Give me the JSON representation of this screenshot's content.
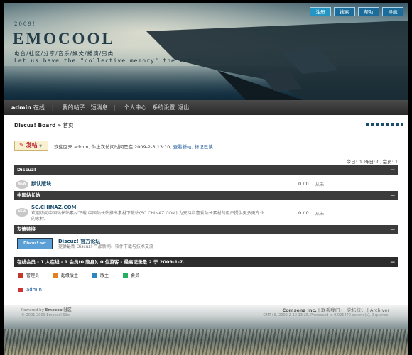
{
  "header": {
    "year": "2009!",
    "logo": "EMOCOOL",
    "slogan_cn": "电台/社区/分享/音乐/娱文/播演/另类...",
    "slogan_en": "Let us have the \"collective memory\" the voice!",
    "top_links": [
      "注册",
      "搜索",
      "帮助",
      "导航"
    ]
  },
  "nav": {
    "user": "admin",
    "status": "在线",
    "items": [
      "我的帖子",
      "短消息",
      "个人中心",
      "系统设置",
      "退出"
    ]
  },
  "breadcrumb": {
    "board": "Discuz! Board",
    "sep": "»",
    "page": "首页"
  },
  "post_button": "发帖",
  "welcome": {
    "text": "欢迎回来 admin, 你上次访问时间是在 2009-2-3 13:10,",
    "link1": "查看新帖",
    "comma": ",",
    "link2": "标记已读"
  },
  "stats": "今日: 0, 昨日: 0, 会员: 1",
  "categories": [
    {
      "title": "Discuz!",
      "toggle": "—"
    },
    {
      "title": "中国站长站",
      "toggle": "—"
    },
    {
      "title": "友情链接",
      "toggle": "—"
    }
  ],
  "forums": [
    {
      "badge": "NEW",
      "name": "默认版块",
      "desc": "",
      "count": "0 / 0",
      "last": "从未"
    },
    {
      "badge": "NEW",
      "name": "SC.CHINAZ.COM",
      "desc": "欢迎访问中国站长站素材下载,中国站长站推出素材下载站(SC.CHINAZ.COM),为支持和喜爱站长素材的用户提供更多更专业的素材。",
      "count": "0 / 0",
      "last": "从未"
    }
  ],
  "partner": {
    "logo_text": "Discuz! net",
    "name": "Discuz! 官方论坛",
    "desc": "提供最新 Discuz! 产品新闻、软件下载与技术交流"
  },
  "online": {
    "bar": "在线会员 - 1 人在线 - 1 会员(0 隐身), 0 位游客 - 最高记录是 2 于 2009-1-7.",
    "toggle": "—",
    "legend": [
      {
        "label": "管理员",
        "color": "#c0392b"
      },
      {
        "label": "超级版主",
        "color": "#e67e22"
      },
      {
        "label": "版主",
        "color": "#2e86c1"
      },
      {
        "label": "会员",
        "color": "#27ae60"
      }
    ],
    "user": "admin"
  },
  "footer": {
    "powered_prefix": "Powered by",
    "powered_name": "Emocool社区",
    "copyright": "© 2001-2009 Emocool Site",
    "company": "Comsenz Inc.",
    "links": "| 联系我们 | | 论坛统计 | Archiver",
    "gmt": "GMT+8, 2009-2-13 13:25, Processed in 0.025470 second(s), 9 queries."
  }
}
